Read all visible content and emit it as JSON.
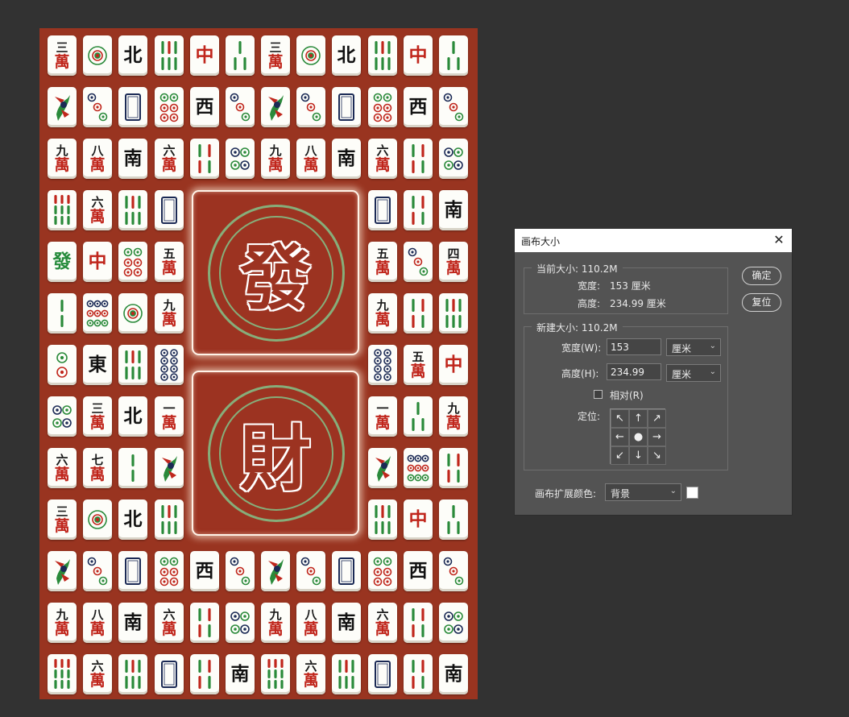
{
  "canvas": {
    "panels": [
      {
        "glyph": "發"
      },
      {
        "glyph": "財"
      }
    ],
    "tiles": [
      {
        "t": "wan",
        "n": "三"
      },
      {
        "t": "dot1"
      },
      {
        "t": "hon",
        "c": "北",
        "k": "black"
      },
      {
        "t": "bam6"
      },
      {
        "t": "hon",
        "c": "中",
        "k": "red"
      },
      {
        "t": "bam3"
      },
      {
        "t": "wan",
        "n": "三"
      },
      {
        "t": "dot1"
      },
      {
        "t": "hon",
        "c": "北",
        "k": "black"
      },
      {
        "t": "bam6"
      },
      {
        "t": "hon",
        "c": "中",
        "k": "red"
      },
      {
        "t": "bam3"
      },
      {
        "t": "bird"
      },
      {
        "t": "dot3"
      },
      {
        "t": "white"
      },
      {
        "t": "dot6"
      },
      {
        "t": "hon",
        "c": "西",
        "k": "black"
      },
      {
        "t": "dot3"
      },
      {
        "t": "bird"
      },
      {
        "t": "dot3"
      },
      {
        "t": "white"
      },
      {
        "t": "dot6"
      },
      {
        "t": "hon",
        "c": "西",
        "k": "black"
      },
      {
        "t": "dot3"
      },
      {
        "t": "wan",
        "n": "九"
      },
      {
        "t": "wan",
        "n": "八"
      },
      {
        "t": "hon",
        "c": "南",
        "k": "black"
      },
      {
        "t": "wan",
        "n": "六"
      },
      {
        "t": "bam4"
      },
      {
        "t": "dot4"
      },
      {
        "t": "wan",
        "n": "九"
      },
      {
        "t": "wan",
        "n": "八"
      },
      {
        "t": "hon",
        "c": "南",
        "k": "black"
      },
      {
        "t": "wan",
        "n": "六"
      },
      {
        "t": "bam4"
      },
      {
        "t": "dot4"
      },
      {
        "t": "bam9"
      },
      {
        "t": "wan",
        "n": "六"
      },
      {
        "t": "bam6"
      },
      {
        "t": "white"
      },
      {
        "t": "white"
      },
      {
        "t": "bam4"
      },
      {
        "t": "hon",
        "c": "南",
        "k": "black"
      },
      {
        "t": "hon",
        "c": "發",
        "k": "green"
      },
      {
        "t": "hon",
        "c": "中",
        "k": "red"
      },
      {
        "t": "dot6"
      },
      {
        "t": "wan",
        "n": "五"
      },
      {
        "t": "wan",
        "n": "五"
      },
      {
        "t": "dot3"
      },
      {
        "t": "wan",
        "n": "四"
      },
      {
        "t": "bam2"
      },
      {
        "t": "dot9"
      },
      {
        "t": "dot1"
      },
      {
        "t": "wan",
        "n": "九"
      },
      {
        "t": "wan",
        "n": "九"
      },
      {
        "t": "bam4"
      },
      {
        "t": "bam6"
      },
      {
        "t": "dot2"
      },
      {
        "t": "hon",
        "c": "東",
        "k": "black"
      },
      {
        "t": "bam6"
      },
      {
        "t": "dot8"
      },
      {
        "t": "dot8"
      },
      {
        "t": "wan",
        "n": "五"
      },
      {
        "t": "hon",
        "c": "中",
        "k": "red"
      },
      {
        "t": "dot4"
      },
      {
        "t": "wan",
        "n": "三"
      },
      {
        "t": "hon",
        "c": "北",
        "k": "black"
      },
      {
        "t": "wan",
        "n": "一"
      },
      {
        "t": "wan",
        "n": "一"
      },
      {
        "t": "bam3"
      },
      {
        "t": "wan",
        "n": "九"
      },
      {
        "t": "wan",
        "n": "六"
      },
      {
        "t": "wan",
        "n": "七"
      },
      {
        "t": "bam2"
      },
      {
        "t": "bird"
      },
      {
        "t": "bird"
      },
      {
        "t": "dot9"
      },
      {
        "t": "bam4"
      },
      {
        "t": "wan",
        "n": "三"
      },
      {
        "t": "dot1"
      },
      {
        "t": "hon",
        "c": "北",
        "k": "black"
      },
      {
        "t": "bam6"
      },
      {
        "t": "bam6"
      },
      {
        "t": "hon",
        "c": "中",
        "k": "red"
      },
      {
        "t": "bam3"
      },
      {
        "t": "bird"
      },
      {
        "t": "dot3"
      },
      {
        "t": "white"
      },
      {
        "t": "dot6"
      },
      {
        "t": "hon",
        "c": "西",
        "k": "black"
      },
      {
        "t": "dot3"
      },
      {
        "t": "bird"
      },
      {
        "t": "dot3"
      },
      {
        "t": "white"
      },
      {
        "t": "dot6"
      },
      {
        "t": "hon",
        "c": "西",
        "k": "black"
      },
      {
        "t": "dot3"
      },
      {
        "t": "wan",
        "n": "九"
      },
      {
        "t": "wan",
        "n": "八"
      },
      {
        "t": "hon",
        "c": "南",
        "k": "black"
      },
      {
        "t": "wan",
        "n": "六"
      },
      {
        "t": "bam4"
      },
      {
        "t": "dot4"
      },
      {
        "t": "wan",
        "n": "九"
      },
      {
        "t": "wan",
        "n": "八"
      },
      {
        "t": "hon",
        "c": "南",
        "k": "black"
      },
      {
        "t": "wan",
        "n": "六"
      },
      {
        "t": "bam4"
      },
      {
        "t": "dot4"
      },
      {
        "t": "bam9"
      },
      {
        "t": "wan",
        "n": "六"
      },
      {
        "t": "bam6"
      },
      {
        "t": "white"
      },
      {
        "t": "bam4"
      },
      {
        "t": "hon",
        "c": "南",
        "k": "black"
      },
      {
        "t": "bam9"
      },
      {
        "t": "wan",
        "n": "六"
      },
      {
        "t": "bam6"
      },
      {
        "t": "white"
      },
      {
        "t": "bam4"
      },
      {
        "t": "hon",
        "c": "南",
        "k": "black"
      }
    ],
    "wan_char": "萬"
  },
  "dialog": {
    "title": "画布大小",
    "current": {
      "legend": "当前大小: 110.2M",
      "width_label": "宽度:",
      "width_value": "153 厘米",
      "height_label": "高度:",
      "height_value": "234.99 厘米"
    },
    "new": {
      "legend": "新建大小: 110.2M",
      "width_label": "宽度(W):",
      "width_value": "153",
      "width_unit": "厘米",
      "height_label": "高度(H):",
      "height_value": "234.99",
      "height_unit": "厘米",
      "relative_label": "相对(R)",
      "anchor_label": "定位:"
    },
    "ext_color_label": "画布扩展颜色:",
    "ext_color_value": "背景",
    "ok_label": "确定",
    "reset_label": "复位",
    "colors": {
      "ext_swatch": "#ffffff"
    }
  }
}
